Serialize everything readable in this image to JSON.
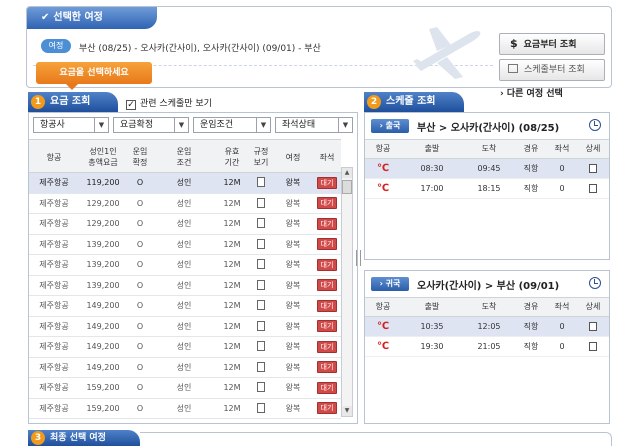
{
  "trip_box": {
    "header": "선택한 여정",
    "pill": "여정",
    "itinerary": "부산 (08/25) - 오사카(간사이), 오사카(간사이) (09/01) - 부산",
    "fare_first_button": "요금부터 조회",
    "fare_first_icon": "$",
    "schedule_first_button": "스케줄부터 조회"
  },
  "tooltip": "요금을 선택하세요",
  "fare_section": {
    "number": "1",
    "title": "요금 조회",
    "related_checkbox": "관련 스케줄만 보기",
    "related_checked": true,
    "filters": [
      "항공사",
      "요금확정",
      "운임조건",
      "좌석상태"
    ],
    "columns": [
      "항공",
      "성인1인\n총액요금",
      "운임\n확정",
      "운임\n조건",
      "유효\n기간",
      "규정\n보기",
      "여정",
      "좌석"
    ],
    "rows": [
      {
        "airline": "제주항공",
        "price": "119,200",
        "fixed": "O",
        "cond": "성인",
        "valid": "12M",
        "trip": "왕복",
        "seat": "대기",
        "selected": true
      },
      {
        "airline": "제주항공",
        "price": "129,200",
        "fixed": "O",
        "cond": "성인",
        "valid": "12M",
        "trip": "왕복",
        "seat": "대기",
        "selected": false
      },
      {
        "airline": "제주항공",
        "price": "129,200",
        "fixed": "O",
        "cond": "성인",
        "valid": "12M",
        "trip": "왕복",
        "seat": "대기",
        "selected": false
      },
      {
        "airline": "제주항공",
        "price": "139,200",
        "fixed": "O",
        "cond": "성인",
        "valid": "12M",
        "trip": "왕복",
        "seat": "대기",
        "selected": false
      },
      {
        "airline": "제주항공",
        "price": "139,200",
        "fixed": "O",
        "cond": "성인",
        "valid": "12M",
        "trip": "왕복",
        "seat": "대기",
        "selected": false
      },
      {
        "airline": "제주항공",
        "price": "139,200",
        "fixed": "O",
        "cond": "성인",
        "valid": "12M",
        "trip": "왕복",
        "seat": "대기",
        "selected": false
      },
      {
        "airline": "제주항공",
        "price": "149,200",
        "fixed": "O",
        "cond": "성인",
        "valid": "12M",
        "trip": "왕복",
        "seat": "대기",
        "selected": false
      },
      {
        "airline": "제주항공",
        "price": "149,200",
        "fixed": "O",
        "cond": "성인",
        "valid": "12M",
        "trip": "왕복",
        "seat": "대기",
        "selected": false
      },
      {
        "airline": "제주항공",
        "price": "149,200",
        "fixed": "O",
        "cond": "성인",
        "valid": "12M",
        "trip": "왕복",
        "seat": "대기",
        "selected": false
      },
      {
        "airline": "제주항공",
        "price": "149,200",
        "fixed": "O",
        "cond": "성인",
        "valid": "12M",
        "trip": "왕복",
        "seat": "대기",
        "selected": false
      },
      {
        "airline": "제주항공",
        "price": "159,200",
        "fixed": "O",
        "cond": "성인",
        "valid": "12M",
        "trip": "왕복",
        "seat": "대기",
        "selected": false
      },
      {
        "airline": "제주항공",
        "price": "159,200",
        "fixed": "O",
        "cond": "성인",
        "valid": "12M",
        "trip": "왕복",
        "seat": "대기",
        "selected": false
      }
    ]
  },
  "schedule_section": {
    "number": "2",
    "title": "스케줄 조회",
    "other_trip_button": "다른 여정 선택",
    "columns": [
      "항공",
      "출발",
      "도착",
      "경유",
      "좌석",
      "상세"
    ],
    "outbound": {
      "badge": "출국",
      "route": "부산 > 오사카(간사이) (08/25)",
      "rows": [
        {
          "dep": "08:30",
          "arr": "09:45",
          "via": "직항",
          "seats": "0",
          "selected": true
        },
        {
          "dep": "17:00",
          "arr": "18:15",
          "via": "직항",
          "seats": "0",
          "selected": false
        }
      ]
    },
    "return": {
      "badge": "귀국",
      "route": "오사카(간사이) > 부산 (09/01)",
      "rows": [
        {
          "dep": "10:35",
          "arr": "12:05",
          "via": "직항",
          "seats": "0",
          "selected": true
        },
        {
          "dep": "19:30",
          "arr": "21:05",
          "via": "직항",
          "seats": "0",
          "selected": false
        }
      ]
    }
  },
  "final_section": {
    "number": "3",
    "title": "최종 선택 여정"
  },
  "colors": {
    "header_blue": "#2f63b3",
    "tooltip_orange": "#e8791a",
    "wait_red": "#d14a4a",
    "selected_row": "#dfe4f3"
  }
}
